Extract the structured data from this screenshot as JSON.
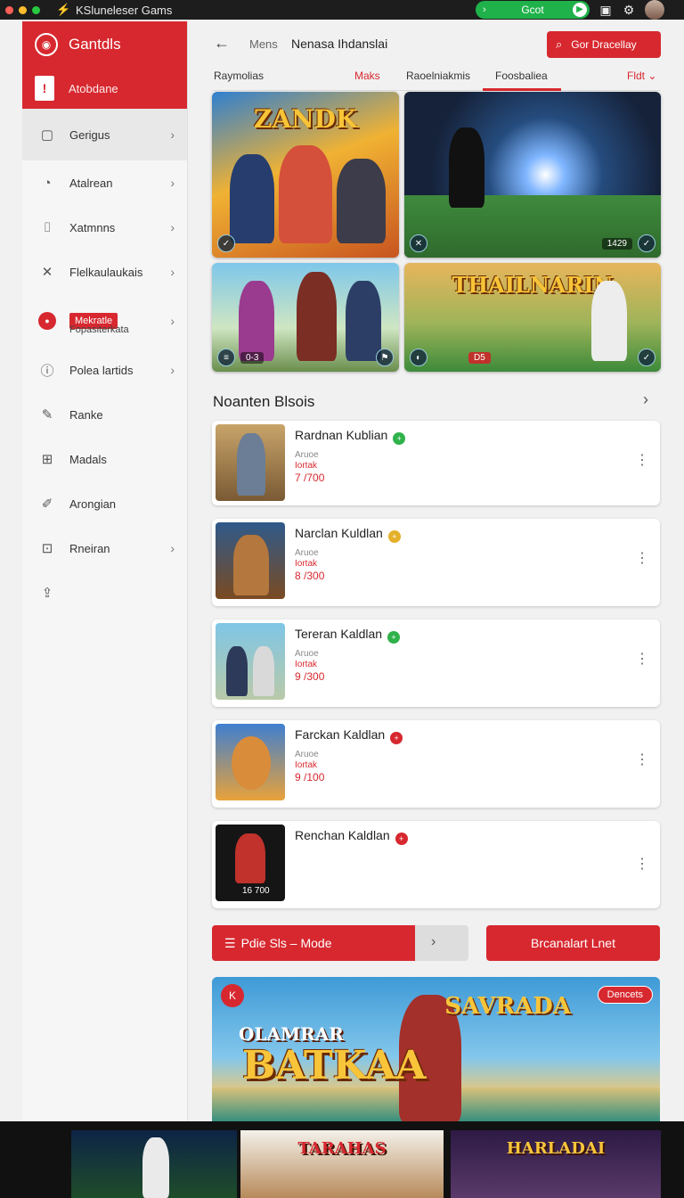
{
  "window": {
    "title": "KSluneleser Gams",
    "go_label": "Gcot"
  },
  "sidebar": {
    "header_title": "Gantdls",
    "sub_label": "Atobdane",
    "items": [
      {
        "label": "Gerigus",
        "icon": "controller-icon"
      },
      {
        "label": "Atalrean",
        "icon": "compass-icon"
      },
      {
        "label": "Xatmnns",
        "icon": "bracket-icon"
      },
      {
        "label": "Flelkaulaukais",
        "icon": "tools-icon"
      },
      {
        "label": "Mekratle",
        "sub": "Fopasiterkata",
        "icon": "record-icon"
      },
      {
        "label": "Polea lartids",
        "icon": "info-icon"
      },
      {
        "label": "Ranke",
        "icon": "wrench-icon"
      },
      {
        "label": "Madals",
        "icon": "grid-icon"
      },
      {
        "label": "Arongian",
        "icon": "edit-icon"
      },
      {
        "label": "Rneiran",
        "icon": "box-icon"
      }
    ]
  },
  "header": {
    "crumb1": "Mens",
    "crumb2": "Nenasa Ihdanslai",
    "cta_label": "Gor Dracellay"
  },
  "tabs": [
    {
      "label": "Raymolias"
    },
    {
      "label": "Maks"
    },
    {
      "label": "Raoelniakmis"
    },
    {
      "label": "Foosbaliea"
    },
    {
      "label": "Fldt"
    }
  ],
  "featured": [
    {
      "caption": "ZANDK",
      "hud": ""
    },
    {
      "caption": "",
      "hud": "1429"
    },
    {
      "caption": "",
      "hud": "0-3"
    },
    {
      "caption": "THAILNARIN",
      "hud": "D5"
    }
  ],
  "section": {
    "title": "Noanten Blsois"
  },
  "list": [
    {
      "title": "Rardnan Kublian",
      "meta1": "Aruoe",
      "meta2": "Iortak",
      "score": "7 /700",
      "dot_color": "#2fb24a"
    },
    {
      "title": "Narclan Kuldlan",
      "meta1": "Aruoe",
      "meta2": "Iortak",
      "score": "8 /300",
      "dot_color": "#e5b12b"
    },
    {
      "title": "Tereran Kaldlan",
      "meta1": "Aruoe",
      "meta2": "Iortak",
      "score": "9 /300",
      "dot_color": "#2fb24a"
    },
    {
      "title": "Farckan Kaldlan",
      "meta1": "Aruoe",
      "meta2": "Iortak",
      "score": "9 /100",
      "dot_color": "#d7282f"
    },
    {
      "title": "Renchan Kaldlan",
      "meta1": "",
      "meta2": "",
      "score": "",
      "dot_color": "#d7282f",
      "thumb_text": "16 700"
    }
  ],
  "buttons": {
    "mode_label": "Pdie Sls – Mode",
    "channel_label": "Brcanalart Lnet"
  },
  "banner": {
    "title1": "OLAMRAR",
    "title2": "BATKAA",
    "title3": "SAVRADA",
    "tag": "Dencets"
  },
  "strip": [
    {
      "caption": ""
    },
    {
      "caption": "TARAHAS"
    },
    {
      "caption": "HARLADAI"
    }
  ],
  "colors": {
    "accent": "#d7282f",
    "green": "#1fb24a",
    "titlebar": "#1d1d1d"
  }
}
